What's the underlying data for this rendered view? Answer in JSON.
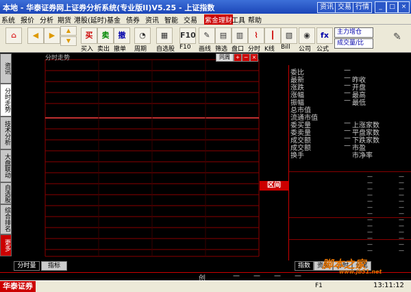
{
  "titlebar": {
    "title": "本地 - 华泰证券网上证券分析系统(专业版II)V5.25 - 上证指数",
    "buttons": [
      "资讯",
      "交易",
      "行情"
    ],
    "win_buttons": [
      "_",
      "□",
      "×"
    ]
  },
  "menu": {
    "items": [
      "系统",
      "报价",
      "分析",
      "期货",
      "港股(延时)",
      "基金",
      "债券",
      "资讯",
      "智能",
      "交易",
      "紫金理财",
      "工具",
      "帮助"
    ],
    "highlighted_index": 10
  },
  "toolbar": {
    "buttons": [
      {
        "glyph": "⌂"
      },
      {
        "glyph": "◀"
      },
      {
        "glyph": "▶"
      },
      {
        "glyph": "▲"
      },
      {
        "glyph": "▼"
      },
      {
        "glyph": "买",
        "label": "买入"
      },
      {
        "glyph": "卖",
        "label": "卖出"
      },
      {
        "glyph": "撤",
        "label": "撤单"
      },
      {
        "glyph": "◔",
        "label": "周期"
      },
      {
        "glyph": "▦",
        "label": "自选股"
      },
      {
        "glyph": "F10",
        "label": "F10"
      },
      {
        "glyph": "✎",
        "label": "画线"
      },
      {
        "glyph": "▤",
        "label": "筛选"
      },
      {
        "glyph": "▥",
        "label": "盘口"
      },
      {
        "glyph": "⌇",
        "label": "分时"
      },
      {
        "glyph": "┃",
        "label": "K线"
      },
      {
        "glyph": "▧",
        "label": "Bill"
      },
      {
        "glyph": "◉",
        "label": "公司"
      },
      {
        "glyph": "fx",
        "label": "公式"
      }
    ],
    "dropdowns": [
      "主力增仓",
      "成交量/比"
    ]
  },
  "left_tabs": [
    "资讯",
    "分时走势",
    "技术分析",
    "大盘联动",
    "自选股",
    "综合排名",
    "更多"
  ],
  "chart": {
    "label": "分时走势",
    "period_label": "同周",
    "zoom_in": "+",
    "zoom_out": "−",
    "close": "×",
    "interval_button": "区间"
  },
  "quote": {
    "rows": [
      {
        "left": "委比",
        "left_val": "—",
        "right": "",
        "right_val": ""
      },
      {
        "left": "最新",
        "left_val": "—",
        "right": "昨收",
        "right_val": ""
      },
      {
        "left": "涨跌",
        "left_val": "—",
        "right": "开盘",
        "right_val": ""
      },
      {
        "left": "涨幅",
        "left_val": "—",
        "right": "最高",
        "right_val": ""
      },
      {
        "left": "振幅",
        "left_val": "—",
        "right": "最低",
        "right_val": ""
      },
      {
        "left": "总市值",
        "left_val": "",
        "right": "",
        "right_val": ""
      },
      {
        "left": "流通市值",
        "left_val": "",
        "right": "",
        "right_val": ""
      },
      {
        "left": "委买量",
        "left_val": "—",
        "right": "上涨家数",
        "right_val": ""
      },
      {
        "left": "委卖量",
        "left_val": "—",
        "right": "平盘家数",
        "right_val": ""
      },
      {
        "left": "成交额",
        "left_val": "—",
        "right": "下跌家数",
        "right_val": ""
      },
      {
        "left": "成交额",
        "left_val": "—",
        "right": "市盈",
        "right_val": ""
      },
      {
        "left": "换手",
        "left_val": "",
        "right": "市净率",
        "right_val": ""
      }
    ],
    "dashes": "—"
  },
  "bottom_tabs": {
    "left": [
      "分时量",
      "指标"
    ],
    "right": [
      "指数",
      "资金",
      "分时",
      "分笔"
    ]
  },
  "statusbar": {
    "item": "创",
    "dash": "—"
  },
  "taskbar": {
    "brand": "华泰证券",
    "tray_label": "F1",
    "time": "13:11:12"
  },
  "watermark": {
    "title": "脚本之家",
    "url": "www.jb51.net"
  },
  "colors": {
    "grid": "#8b0000",
    "midline": "#ff4040",
    "accent": "#cc0000"
  }
}
